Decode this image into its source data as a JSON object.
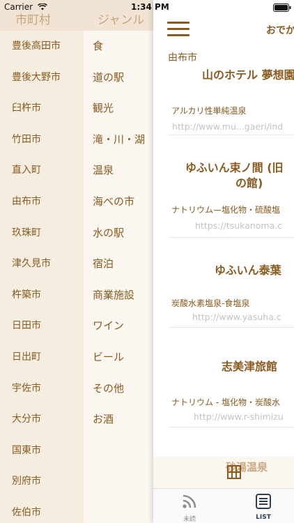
{
  "status_bar": {
    "carrier": "Carrier",
    "time": "1:34 PM"
  },
  "drawer": {
    "header": {
      "city_label": "市町村",
      "genre_label": "ジャンル"
    },
    "cities": [
      "豊後高田市",
      "豊後大野市",
      "臼杵市",
      "竹田市",
      "直入町",
      "由布市",
      "玖珠町",
      "津久見市",
      "杵築市",
      "日田市",
      "日出町",
      "宇佐市",
      "大分市",
      "国東市",
      "別府市",
      "佐伯市"
    ],
    "genres": [
      "食",
      "道の駅",
      "観光",
      "滝・川・湖",
      "温泉",
      "海べの市",
      "水の駅",
      "宿泊",
      "商業施設",
      "ワイン",
      "ビール",
      "その他",
      "お酒"
    ]
  },
  "main": {
    "nav_title": "おでか",
    "section": "由布市",
    "cards": [
      {
        "title": "山のホテル 夢想園",
        "title2": "",
        "type": "アルカリ性単純温泉",
        "url": "http://www.mu...gaeri/ind"
      },
      {
        "title": "ゆふいん束ノ間 (旧 ",
        "title2": "の館)",
        "type": "ナトリウム—塩化物・硫酸塩",
        "url": "https://tsukanoma.c"
      },
      {
        "title": "ゆふいん泰葉",
        "title2": "",
        "type": "炭酸水素塩泉-食塩泉",
        "url": "http://www.yasuha.c"
      },
      {
        "title": "志美津旅館",
        "title2": "",
        "type": "ナトリウム - 塩化物・炭酸水",
        "url": "http://www.r-shimizu"
      }
    ],
    "partial_item": "砂湯温泉"
  },
  "tabs": [
    {
      "label": "未読",
      "icon": "rss-icon"
    },
    {
      "label": "LIST",
      "icon": "list-icon"
    }
  ],
  "colors": {
    "accent": "#8a5a1f",
    "drawer_bg": "#f6ede1",
    "genre_bg": "#fbf6ef",
    "url": "#c3c3c3"
  }
}
